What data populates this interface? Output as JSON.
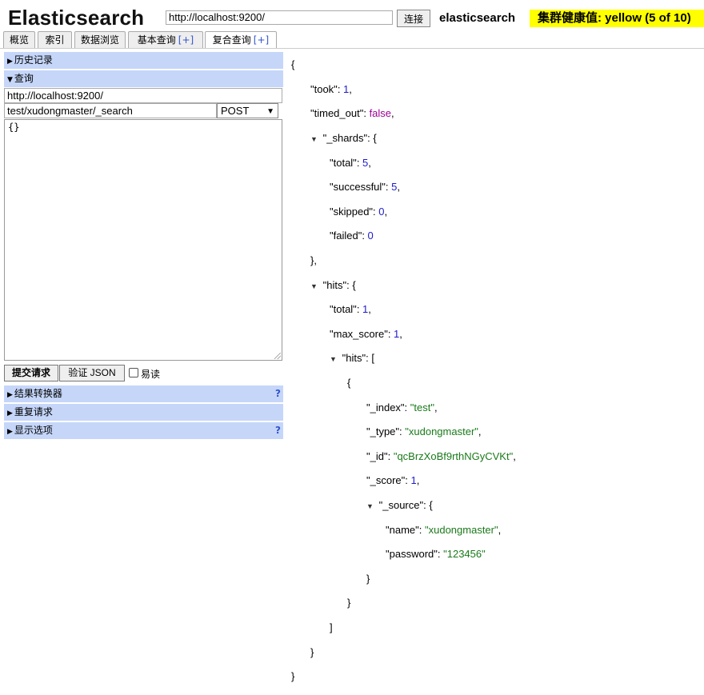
{
  "header": {
    "app_title": "Elasticsearch",
    "url_value": "http://localhost:9200/",
    "connect_label": "连接",
    "cluster_name": "elasticsearch",
    "cluster_health": "集群健康值: yellow (5 of 10)",
    "health_color": "#ffff00"
  },
  "tabs": [
    {
      "label": "概览"
    },
    {
      "label": "索引"
    },
    {
      "label": "数据浏览"
    },
    {
      "label": "基本查询",
      "plus": "[+]"
    },
    {
      "label": "复合查询",
      "plus": "[+]",
      "active": true
    }
  ],
  "left": {
    "history_label": "历史记录",
    "query_label": "查询",
    "host_value": "http://localhost:9200/",
    "path_value": "test/xudongmaster/_search",
    "method_value": "POST",
    "body_value": "{}",
    "submit_label": "提交请求",
    "validate_label": "验证 JSON",
    "pretty_label": "易读",
    "result_transformer_label": "结果转换器",
    "repeat_request_label": "重复请求",
    "display_options_label": "显示选项",
    "help_mark": "?"
  },
  "response": {
    "took": 1,
    "timed_out": false,
    "_shards": {
      "total": 5,
      "successful": 5,
      "skipped": 0,
      "failed": 0
    },
    "hits": {
      "total": 1,
      "max_score": 1,
      "hits": [
        {
          "_index": "test",
          "_type": "xudongmaster",
          "_id": "qcBrzXoBf9rthNGyCVKt",
          "_score": 1,
          "_source": {
            "name": "xudongmaster",
            "password": "123456"
          }
        }
      ]
    }
  }
}
